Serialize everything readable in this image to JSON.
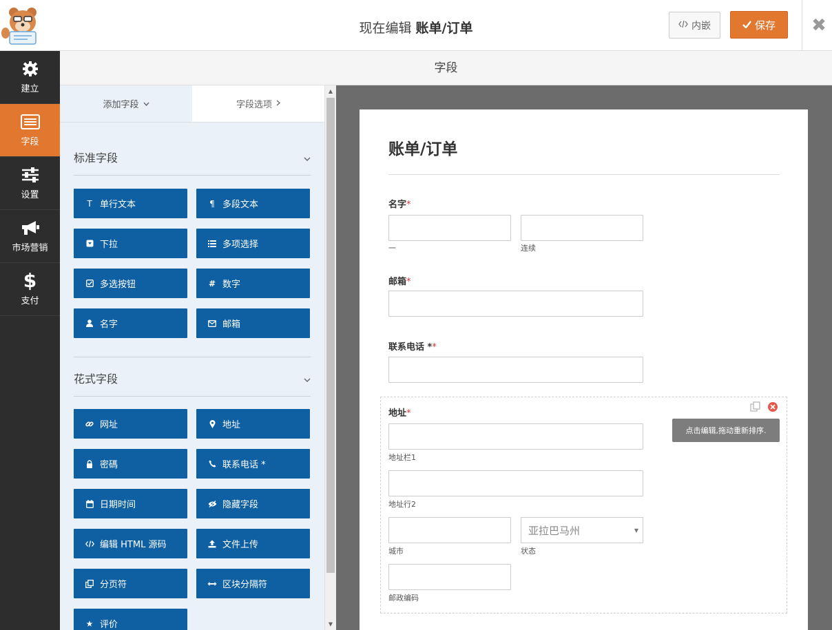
{
  "header": {
    "title_prefix": "现在编辑",
    "title_form": "账单/订单",
    "embed_label": "内嵌",
    "save_label": "保存",
    "close_symbol": "✖"
  },
  "nav": {
    "items": [
      {
        "label": "建立",
        "icon": "gear-icon",
        "active": false
      },
      {
        "label": "字段",
        "icon": "fields-list-icon",
        "active": true
      },
      {
        "label": "设置",
        "icon": "sliders-icon",
        "active": false
      },
      {
        "label": "市场营销",
        "icon": "megaphone-icon",
        "active": false
      },
      {
        "label": "支付",
        "icon": "dollar-icon",
        "active": false
      }
    ]
  },
  "panel": {
    "title": "字段"
  },
  "sidebar": {
    "tab_add": "添加字段",
    "tab_options": "字段选项",
    "standard_title": "标准字段",
    "fancy_title": "花式字段",
    "standard_fields": [
      {
        "label": "单行文本",
        "icon": "text-icon"
      },
      {
        "label": "多段文本",
        "icon": "paragraph-icon"
      },
      {
        "label": "下拉",
        "icon": "dropdown-icon"
      },
      {
        "label": "多项选择",
        "icon": "list-icon"
      },
      {
        "label": "多选按钮",
        "icon": "checkbox-icon"
      },
      {
        "label": "数字",
        "icon": "hash-icon"
      },
      {
        "label": "名字",
        "icon": "user-icon"
      },
      {
        "label": "邮箱",
        "icon": "envelope-icon"
      }
    ],
    "fancy_fields": [
      {
        "label": "网址",
        "icon": "link-icon"
      },
      {
        "label": "地址",
        "icon": "map-pin-icon"
      },
      {
        "label": "密碼",
        "icon": "lock-icon"
      },
      {
        "label": "联系电话 *",
        "icon": "phone-icon"
      },
      {
        "label": "日期时间",
        "icon": "calendar-icon"
      },
      {
        "label": "隐藏字段",
        "icon": "eye-slash-icon"
      },
      {
        "label": "编辑 HTML 源码",
        "icon": "code-icon"
      },
      {
        "label": "文件上传",
        "icon": "upload-icon"
      },
      {
        "label": "分页符",
        "icon": "copy-pages-icon"
      },
      {
        "label": "区块分隔符",
        "icon": "arrows-h-icon"
      },
      {
        "label": "评价",
        "icon": "star-icon"
      }
    ]
  },
  "form": {
    "title": "账单/订单",
    "name_label": "名字",
    "name_first": "一",
    "name_last": "连续",
    "email_label": "邮箱",
    "phone_label": "联系电话 *",
    "address_label": "地址",
    "address_line1": "地址栏1",
    "address_line2": "地址行2",
    "city": "城市",
    "state": "状态",
    "state_selected": "亚拉巴马州",
    "zip": "邮政编码",
    "tooltip": "点击编辑,拖动重新排序.",
    "required_mark": "*"
  }
}
